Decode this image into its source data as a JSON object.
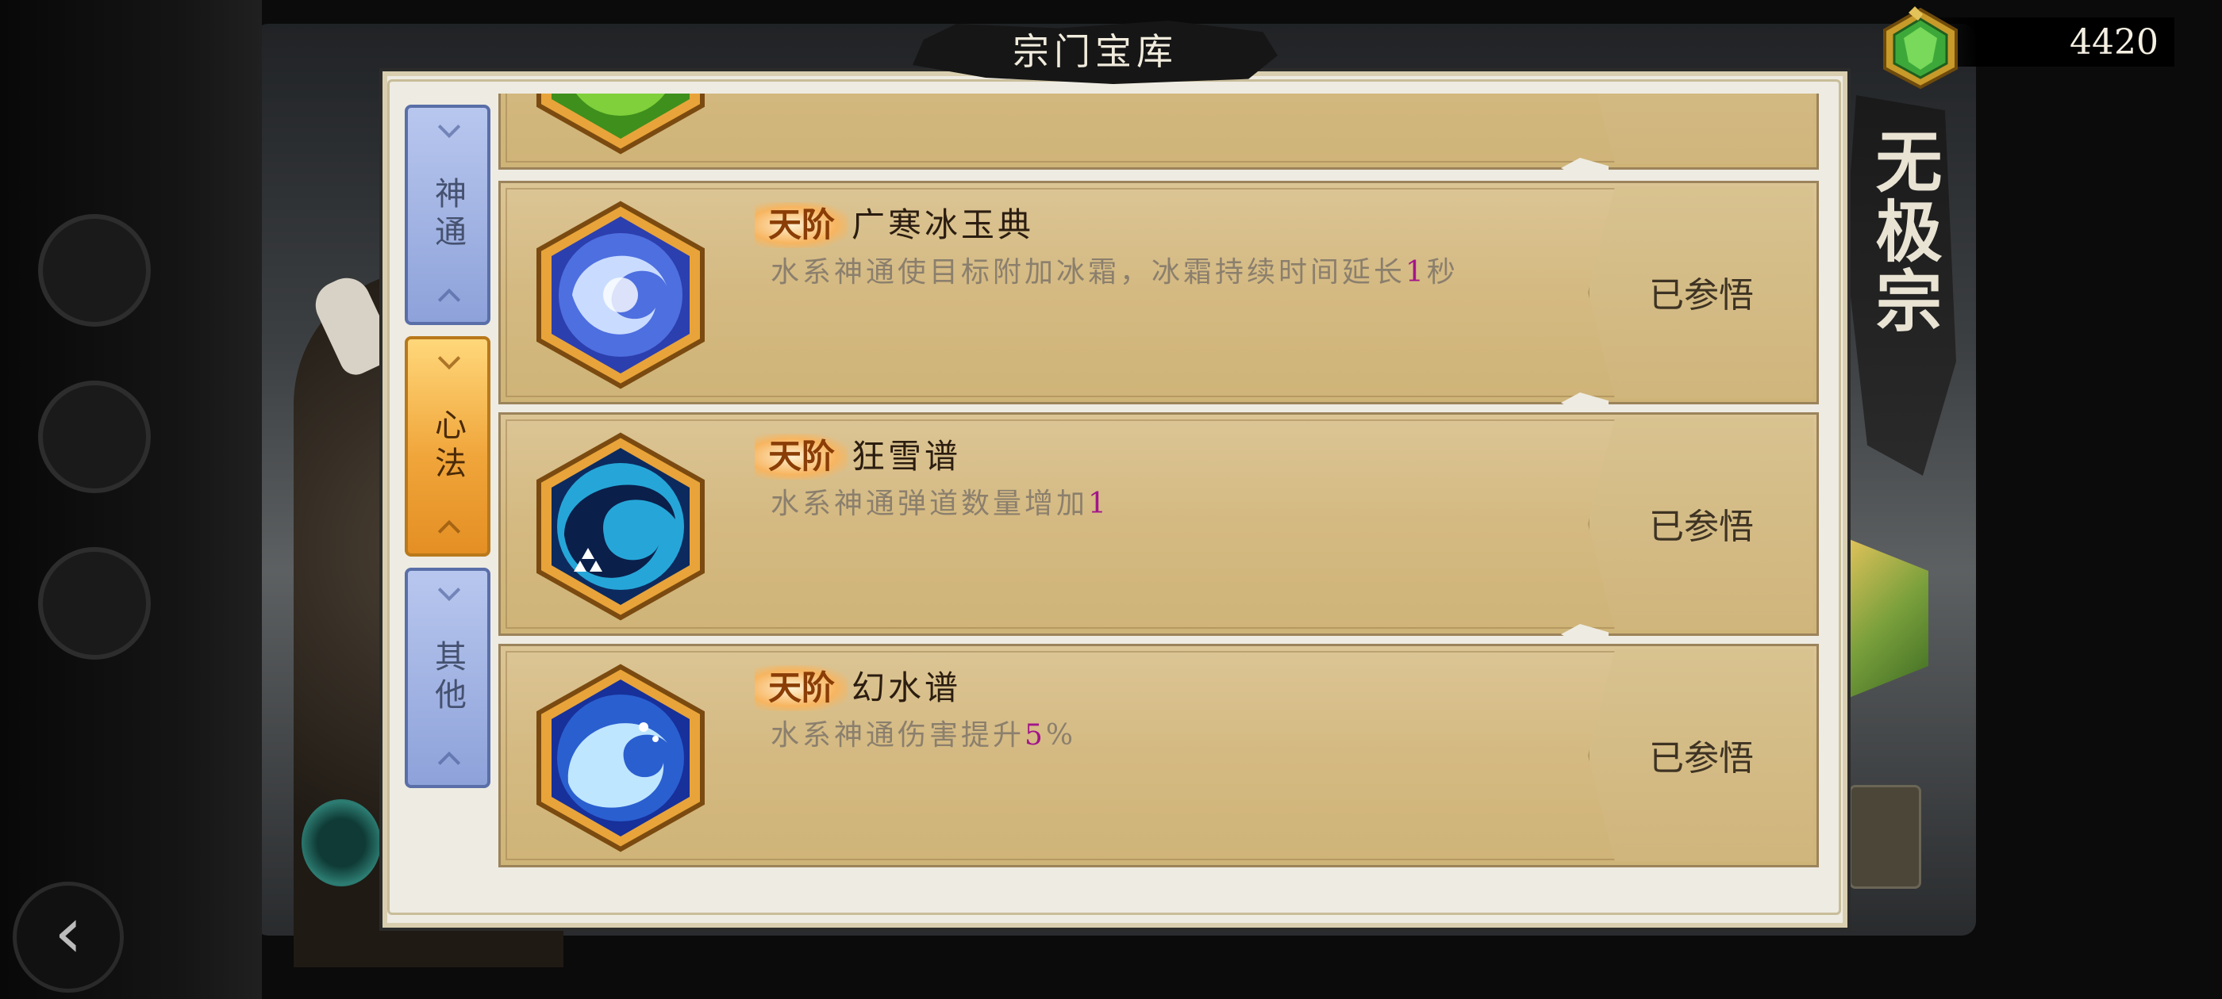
{
  "header": {
    "title": "宗门宝库"
  },
  "currency": {
    "value": "4420",
    "icon": "green-gem-icon"
  },
  "sect": {
    "name": "无极宗"
  },
  "tabs": [
    {
      "label": "神通",
      "active": false
    },
    {
      "label": "心法",
      "active": true
    },
    {
      "label": "其他",
      "active": false
    }
  ],
  "items": [
    {
      "icon": "wind-orb-icon",
      "tier": "",
      "name": "",
      "desc_pre": "",
      "desc_hl": "",
      "desc_post": "",
      "status": ""
    },
    {
      "icon": "ice-swirl-icon",
      "tier": "天阶",
      "name": "广寒冰玉典",
      "desc_pre": "水系神通使目标附加冰霜，冰霜持续时间延长",
      "desc_hl": "1",
      "desc_post": "秒",
      "status": "已参悟"
    },
    {
      "icon": "snow-vortex-icon",
      "tier": "天阶",
      "name": "狂雪谱",
      "desc_pre": "水系神通弹道数量增加",
      "desc_hl": "1",
      "desc_post": "",
      "status": "已参悟"
    },
    {
      "icon": "water-wave-icon",
      "tier": "天阶",
      "name": "幻水谱",
      "desc_pre": "水系神通伤害提升",
      "desc_hl": "5",
      "desc_post": "%",
      "status": "已参悟"
    }
  ],
  "colors": {
    "highlight": "#a2168a",
    "tab_active": "#f0a53a",
    "tab_inactive": "#8ea2da",
    "row_bg": "#d4b981"
  }
}
